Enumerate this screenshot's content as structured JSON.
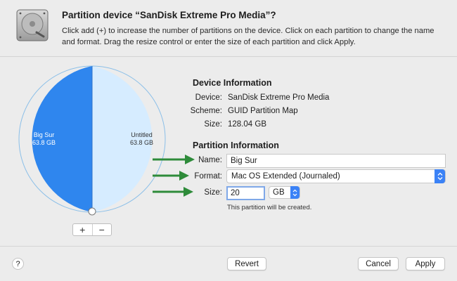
{
  "header": {
    "title": "Partition device “SanDisk Extreme Pro Media”?",
    "description": "Click add (+) to increase the number of partitions on the device. Click on each partition to change the name and format. Drag the resize control or enter the size of each partition and click Apply."
  },
  "pie": {
    "colors": {
      "left": "#2f86ee",
      "right": "#d6ecff",
      "border": "#8bbfe8"
    },
    "slices": [
      {
        "name": "Big Sur",
        "size": "63.8 GB",
        "fraction": 0.5
      },
      {
        "name": "Untitled",
        "size": "63.8 GB",
        "fraction": 0.5
      }
    ],
    "add_label": "+",
    "remove_label": "−"
  },
  "device_info": {
    "section_title": "Device Information",
    "rows": [
      {
        "label": "Device:",
        "value": "SanDisk Extreme Pro Media"
      },
      {
        "label": "Scheme:",
        "value": "GUID Partition Map"
      },
      {
        "label": "Size:",
        "value": "128.04 GB"
      }
    ]
  },
  "partition_info": {
    "section_title": "Partition Information",
    "name_label": "Name:",
    "name_value": "Big Sur",
    "format_label": "Format:",
    "format_value": "Mac OS Extended (Journaled)",
    "size_label": "Size:",
    "size_value": "20",
    "size_unit": "GB",
    "note": "This partition will be created."
  },
  "footer": {
    "help_label": "?",
    "revert_label": "Revert",
    "cancel_label": "Cancel",
    "apply_label": "Apply"
  },
  "annotation_color": "#2e8b3a"
}
